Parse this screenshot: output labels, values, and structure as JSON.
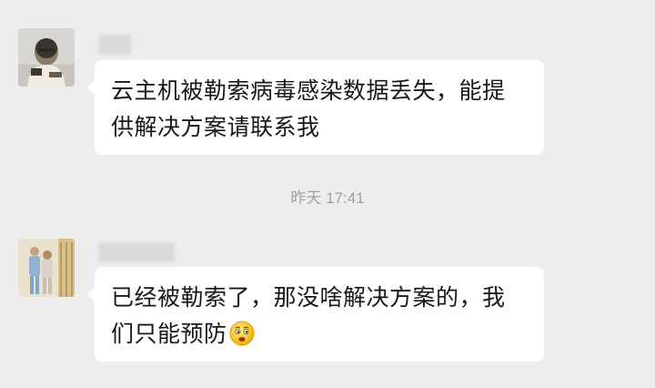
{
  "chat": {
    "messages": [
      {
        "lines": [
          "云主机被勒索病毒感染数据丢失，能提",
          "供解决方案请联系我"
        ]
      },
      {
        "lines": [
          "已经被勒索了，那没啥解决方案的，我",
          "们只能预防"
        ],
        "emoji": "thinking-face-emoji"
      }
    ],
    "timestamp": "昨天 17:41"
  },
  "colors": {
    "background": "#ededed",
    "bubble": "#ffffff",
    "text": "#181818",
    "timestamp": "#a0a0a0"
  }
}
